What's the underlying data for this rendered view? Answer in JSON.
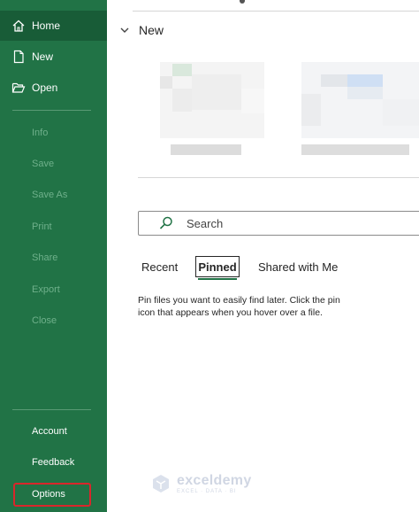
{
  "sidebar": {
    "top_items": [
      {
        "label": "Home",
        "icon": "home-icon"
      },
      {
        "label": "New",
        "icon": "new-file-icon"
      },
      {
        "label": "Open",
        "icon": "open-folder-icon"
      }
    ],
    "disabled_items": [
      "Info",
      "Save",
      "Save As",
      "Print",
      "Share",
      "Export",
      "Close"
    ],
    "bottom_items": [
      "Account",
      "Feedback",
      "Options"
    ]
  },
  "main": {
    "new_section": {
      "title": "New"
    },
    "search": {
      "placeholder": "Search"
    },
    "tabs": [
      {
        "label": "Recent"
      },
      {
        "label": "Pinned"
      },
      {
        "label": "Shared with Me"
      }
    ],
    "pinned_message": "Pin files you want to easily find later. Click the pin icon that appears when you hover over a file."
  },
  "watermark": {
    "name": "exceldemy",
    "tagline": "EXCEL · DATA · BI"
  },
  "colors": {
    "sidebar": "#217346",
    "active": "#185c37",
    "highlight_box": "#d9262b",
    "accent": "#217346"
  }
}
